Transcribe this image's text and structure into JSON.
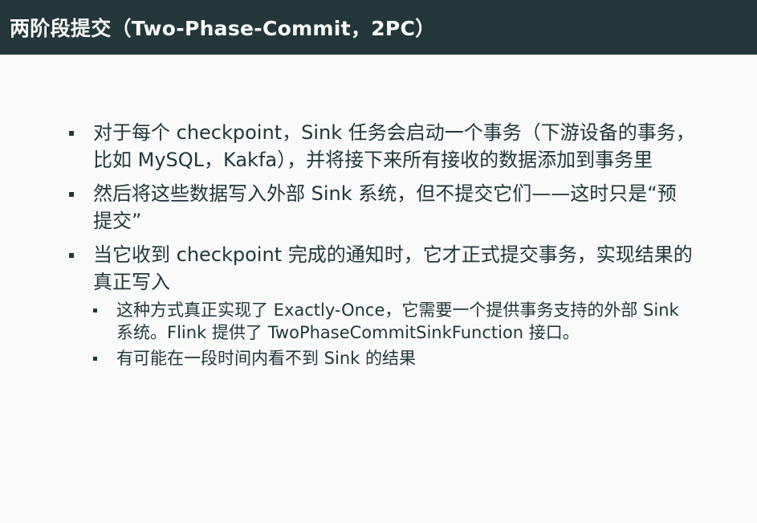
{
  "slide": {
    "title": "两阶段提交（Two-Phase-Commit，2PC）"
  },
  "bullets": [
    {
      "text": "对于每个 checkpoint，Sink 任务会启动一个事务（下游设备的事务，比如 MySQL，Kakfa），并将接下来所有接收的数据添加到事务里"
    },
    {
      "text": "然后将这些数据写入外部 Sink 系统，但不提交它们——这时只是“预提交”"
    },
    {
      "text": "当它收到 checkpoint 完成的通知时，它才正式提交事务，实现结果的真正写入",
      "subitems": [
        "这种方式真正实现了 Exactly-Once，它需要一个提供事务支持的外部 Sink 系统。Flink 提供了 TwoPhaseCommitSinkFunction 接口。",
        "有可能在一段时间内看不到 Sink 的结果"
      ]
    }
  ]
}
